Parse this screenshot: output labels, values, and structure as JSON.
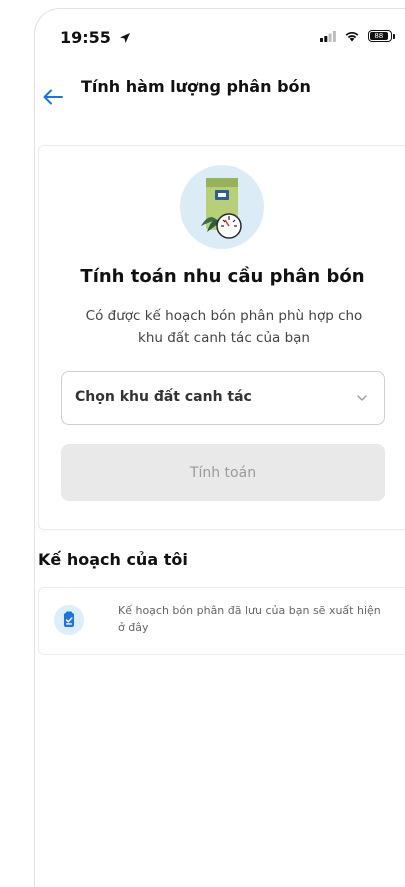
{
  "status_bar": {
    "time": "19:55",
    "battery_level": "88"
  },
  "header": {
    "title": "Tính hàm lượng phân bón"
  },
  "calculator_card": {
    "title": "Tính toán nhu cầu phân bón",
    "description": "Có được kế hoạch bón phân phù hợp cho khu đất canh tác của bạn",
    "select_placeholder": "Chọn khu đất canh tác",
    "calculate_label": "Tính toán"
  },
  "my_plans": {
    "title": "Kế hoạch của tôi",
    "empty_message": "Kế hoạch bón phân đã lưu của bạn sẽ xuất hiện ở đây"
  },
  "colors": {
    "accent": "#1a73e8",
    "button_disabled_bg": "#e9e9e9",
    "button_disabled_text": "#9a9a9a"
  }
}
